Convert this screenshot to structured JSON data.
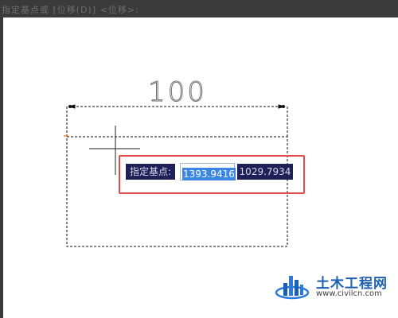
{
  "window": {
    "title_bar_text": "指定基点或 [位移(D)] <位移>:"
  },
  "drawing": {
    "dimension_value": "100"
  },
  "command_prompt": {
    "label": "指定基点:",
    "x_value": "1393.9416",
    "y_value": "1029.7934"
  },
  "watermark": {
    "title": "土木工程网",
    "url": "www.civilcn.com"
  },
  "colors": {
    "highlight_frame": "#e14b4b",
    "prompt_background": "#1f2058",
    "selection": "#3b86e6",
    "watermark_brand": "#1e5fb4"
  }
}
